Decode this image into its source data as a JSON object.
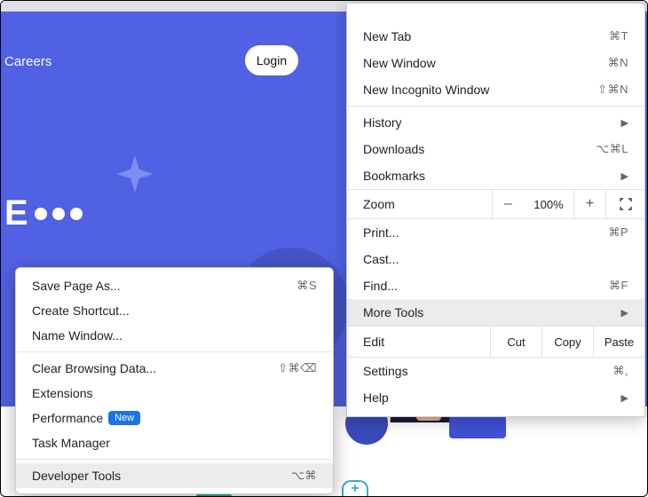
{
  "page": {
    "nav_careers": "Careers",
    "login": "Login",
    "hero_fragment": "E"
  },
  "menu": {
    "new_tab": {
      "label": "New Tab",
      "shortcut": "⌘T"
    },
    "new_window": {
      "label": "New Window",
      "shortcut": "⌘N"
    },
    "new_incognito": {
      "label": "New Incognito Window",
      "shortcut": "⇧⌘N"
    },
    "history": {
      "label": "History"
    },
    "downloads": {
      "label": "Downloads",
      "shortcut": "⌥⌘L"
    },
    "bookmarks": {
      "label": "Bookmarks"
    },
    "zoom": {
      "label": "Zoom",
      "minus": "–",
      "value": "100%",
      "plus": "+"
    },
    "print": {
      "label": "Print...",
      "shortcut": "⌘P"
    },
    "cast": {
      "label": "Cast..."
    },
    "find": {
      "label": "Find...",
      "shortcut": "⌘F"
    },
    "more_tools": {
      "label": "More Tools"
    },
    "edit": {
      "label": "Edit",
      "cut": "Cut",
      "copy": "Copy",
      "paste": "Paste"
    },
    "settings": {
      "label": "Settings",
      "shortcut": "⌘,"
    },
    "help": {
      "label": "Help"
    }
  },
  "submenu": {
    "save_page": {
      "label": "Save Page As...",
      "shortcut": "⌘S"
    },
    "create_shortcut": {
      "label": "Create Shortcut..."
    },
    "name_window": {
      "label": "Name Window..."
    },
    "clear_browsing": {
      "label": "Clear Browsing Data...",
      "shortcut": "⇧⌘⌫"
    },
    "extensions": {
      "label": "Extensions"
    },
    "performance": {
      "label": "Performance",
      "badge": "New"
    },
    "task_manager": {
      "label": "Task Manager"
    },
    "developer_tools": {
      "label": "Developer Tools",
      "shortcut": "⌥⌘"
    }
  }
}
